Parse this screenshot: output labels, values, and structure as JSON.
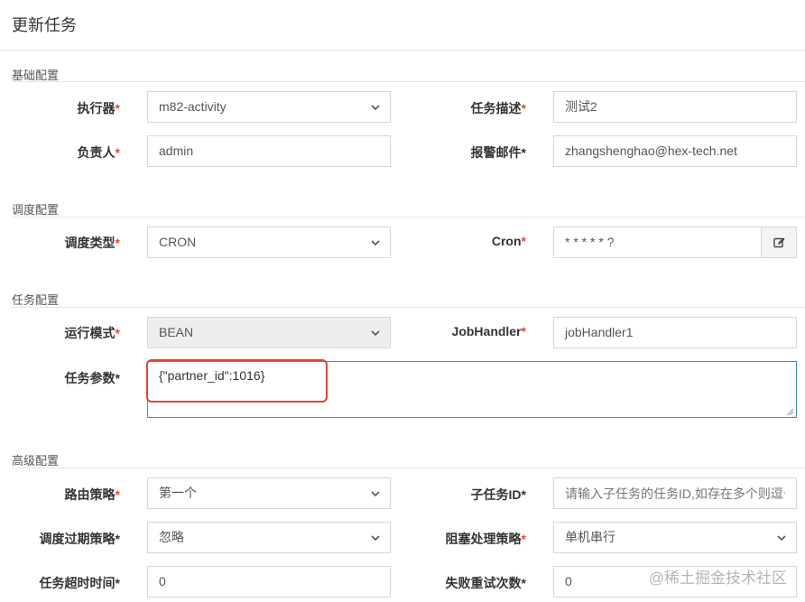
{
  "title": "更新任务",
  "required_mark": "*",
  "sections": {
    "basic": "基础配置",
    "schedule": "调度配置",
    "task": "任务配置",
    "advanced": "高级配置"
  },
  "basic": {
    "executor_label": "执行器",
    "executor_value": "m82-activity",
    "desc_label": "任务描述",
    "desc_value": "测试2",
    "owner_label": "负责人",
    "owner_value": "admin",
    "alarm_label": "报警邮件",
    "alarm_value": "zhangshenghao@hex-tech.net"
  },
  "schedule": {
    "type_label": "调度类型",
    "type_value": "CRON",
    "cron_label": "Cron",
    "cron_value": "* * * * * ?"
  },
  "task": {
    "mode_label": "运行模式",
    "mode_value": "BEAN",
    "handler_label": "JobHandler",
    "handler_value": "jobHandler1",
    "params_label": "任务参数",
    "params_value": "{\"partner_id\":1016}"
  },
  "advanced": {
    "route_label": "路由策略",
    "route_value": "第一个",
    "child_label": "子任务ID",
    "child_placeholder": "请输入子任务的任务ID,如存在多个则逗号分隔",
    "misfire_label": "调度过期策略",
    "misfire_value": "忽略",
    "block_label": "阻塞处理策略",
    "block_value": "单机串行",
    "timeout_label": "任务超时时间",
    "timeout_value": "0",
    "retry_label": "失败重试次数",
    "retry_value": "0"
  },
  "watermark": "@稀土掘金技术社区",
  "colors": {
    "required": "#dd4b39",
    "focus_border": "#3c8dbc",
    "highlight": "#e0443a"
  },
  "icons": {
    "select_arrow": "chevron-down-icon",
    "edit": "edit-icon"
  }
}
